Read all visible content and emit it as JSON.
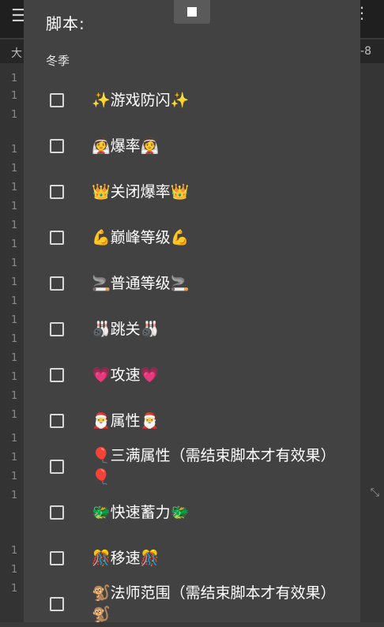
{
  "background": {
    "sub_left": "大",
    "sub_right": "-8",
    "side_lines": [
      "1",
      "1",
      "1",
      "1",
      "1",
      "1",
      "1",
      "1",
      "1",
      "1",
      "1",
      "1",
      "1",
      "1",
      "1",
      "1",
      "1",
      "1",
      "1",
      "1",
      "1",
      "1",
      "1",
      "1",
      "1"
    ]
  },
  "dialog": {
    "title": "脚本:",
    "section": "冬季",
    "items": [
      {
        "label": "✨游戏防闪✨",
        "checked": false
      },
      {
        "label": "👰爆率👰",
        "checked": false
      },
      {
        "label": "👑关闭爆率👑",
        "checked": false
      },
      {
        "label": "💪巅峰等级💪",
        "checked": false
      },
      {
        "label": "🚬普通等级🚬",
        "checked": false
      },
      {
        "label": "🎳跳关🎳",
        "checked": false
      },
      {
        "label": "💗攻速💗",
        "checked": false
      },
      {
        "label": "🎅属性🎅",
        "checked": false
      },
      {
        "label": "🎈三满属性（需结束脚本才有效果）🎈",
        "checked": false
      },
      {
        "label": "🐲快速蓄力🐲",
        "checked": false
      },
      {
        "label": "🎊移速🎊",
        "checked": false
      },
      {
        "label": "🐒法师范围（需结束脚本才有效果）🐒",
        "checked": false
      }
    ]
  },
  "colors": {
    "dialog_bg": "#424242",
    "checkbox_border": "#d8d8d8",
    "text": "#ffffff"
  }
}
